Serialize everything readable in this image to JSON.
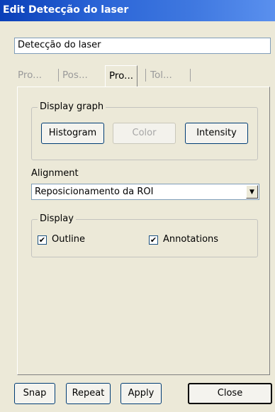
{
  "window": {
    "title": "Edit Detecção do laser"
  },
  "name_field": {
    "value": "Detecção do laser"
  },
  "tabs": [
    {
      "label": "Pro...",
      "active": false
    },
    {
      "label": "Pos...",
      "active": false
    },
    {
      "label": "Pro...",
      "active": true
    },
    {
      "label": "Tol...",
      "active": false
    }
  ],
  "display_graph": {
    "legend": "Display graph",
    "histogram_label": "Histogram",
    "color_label": "Color",
    "intensity_label": "Intensity"
  },
  "alignment": {
    "label": "Alignment",
    "selected": "Reposicionamento da ROI"
  },
  "display": {
    "legend": "Display",
    "outline_label": "Outline",
    "outline_checked": true,
    "annotations_label": "Annotations",
    "annotations_checked": true
  },
  "footer": {
    "snap_label": "Snap",
    "repeat_label": "Repeat",
    "apply_label": "Apply",
    "close_label": "Close"
  },
  "colors": {
    "titlebar": "#2a64d6",
    "dialog_bg": "#ece9d8",
    "button_border": "#003c74"
  }
}
